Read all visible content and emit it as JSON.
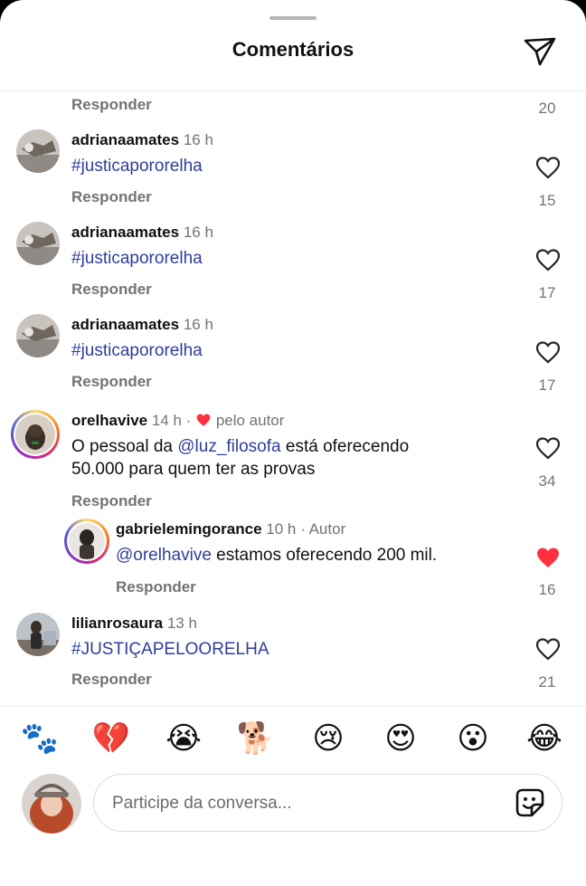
{
  "header": {
    "title": "Comentários"
  },
  "top_partial": {
    "reply_label": "Responder",
    "likes": "20"
  },
  "comments": [
    {
      "username": "adrianaamates",
      "time": "16 h",
      "text": "#justicapororelha",
      "reply_label": "Responder",
      "likes": "15"
    },
    {
      "username": "adrianaamates",
      "time": "16 h",
      "text": "#justicapororelha",
      "reply_label": "Responder",
      "likes": "17"
    },
    {
      "username": "adrianaamates",
      "time": "16 h",
      "text": "#justicapororelha",
      "reply_label": "Responder",
      "likes": "17"
    },
    {
      "username": "orelhavive",
      "time": "14 h",
      "separator": "·",
      "author_badge": "pelo autor",
      "text_before": "O pessoal da ",
      "mention": "@luz_filosofa",
      "text_line1_after": " está oferecendo",
      "text_line2": "50.000 para quem ter as provas",
      "reply_label": "Responder",
      "likes": "34"
    },
    {
      "username": "gabrielemingorance",
      "time": "10 h",
      "separator": "·",
      "author_label": "Autor",
      "mention": "@orelhavive",
      "text_after": " estamos oferecendo 200 mil.",
      "reply_label": "Responder",
      "likes": "16",
      "liked": true
    },
    {
      "username": "lilianrosaura",
      "time": "13 h",
      "text": "#JUSTIÇAPELOORELHA",
      "reply_label": "Responder",
      "likes": "21"
    }
  ],
  "emoji_bar": [
    "🐾",
    "💔",
    "😭",
    "🐕",
    "😢",
    "😍",
    "😮",
    "😂"
  ],
  "composer": {
    "placeholder": "Participe da conversa..."
  },
  "icons": {
    "send": "send-icon",
    "heart": "heart-icon",
    "sticker": "sticker-icon"
  },
  "colors": {
    "like_red": "#ff3040",
    "link_blue": "#2e3d9c",
    "secondary_text": "#737373"
  }
}
